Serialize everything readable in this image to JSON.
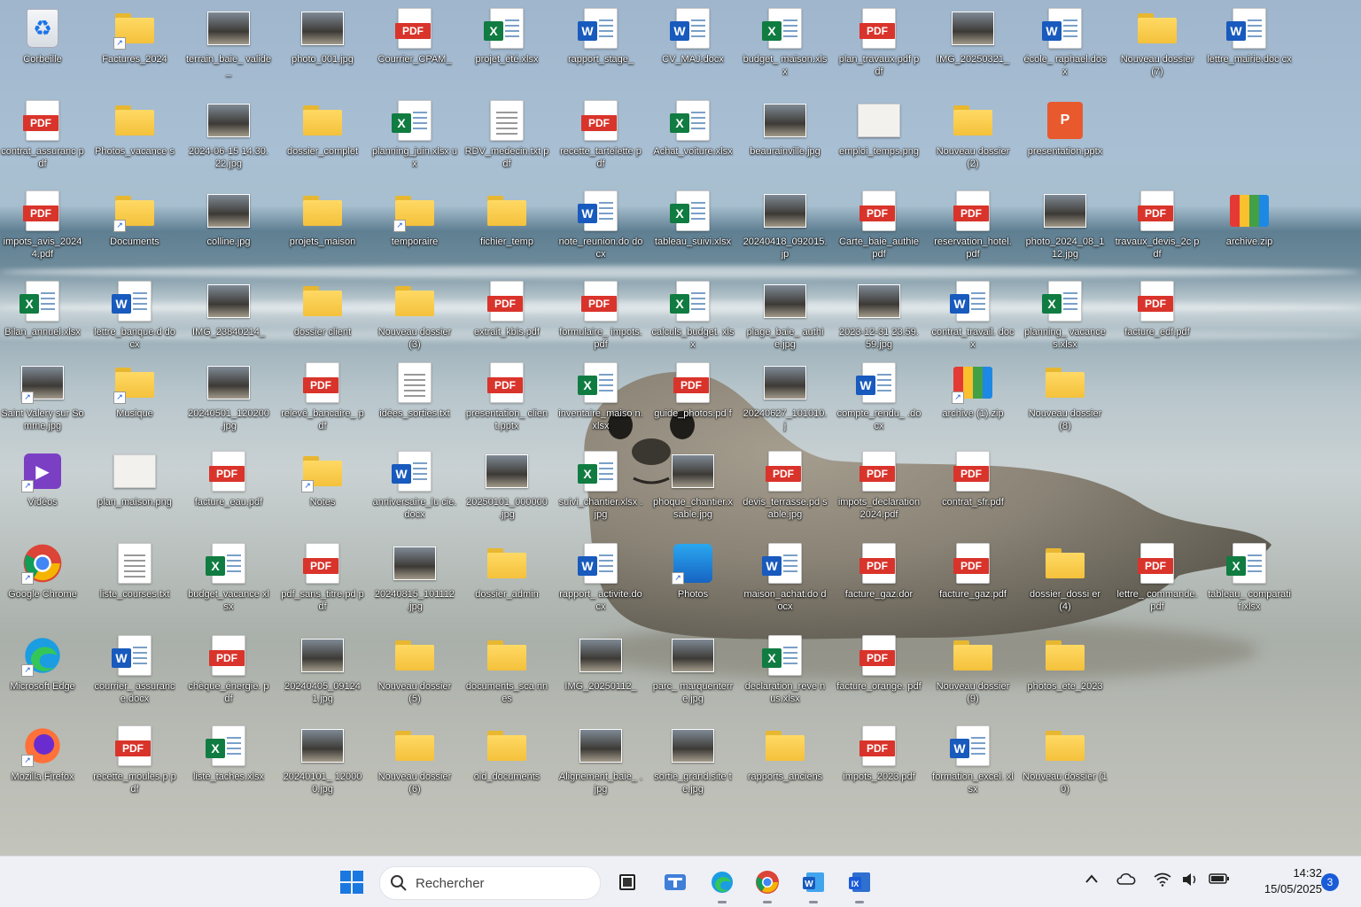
{
  "desktop": {
    "icons": [
      {
        "label": "Corbeille",
        "type": "recycle"
      },
      {
        "label": "Factures_2024",
        "type": "folder",
        "shortcut": true
      },
      {
        "label": "terrain_baie_ valide_",
        "type": "photo"
      },
      {
        "label": "photo_001.jpg",
        "type": "photo"
      },
      {
        "label": "Courrier_CPAM_",
        "type": "pdf"
      },
      {
        "label": "projet_été.xlsx",
        "type": "excel"
      },
      {
        "label": "rapport_stage_",
        "type": "word"
      },
      {
        "label": "CV_MAJ.docx",
        "type": "word"
      },
      {
        "label": "budget_ maison.xlsx",
        "type": "excel"
      },
      {
        "label": "plan_travaux.pdf pdf",
        "type": "pdf"
      },
      {
        "label": "IMG_20250321_",
        "type": "photo"
      },
      {
        "label": "école_ raphael.docx",
        "type": "word"
      },
      {
        "label": "Nouveau dossier (7)",
        "type": "folder"
      },
      {
        "label": "lettre_mairie.doc cx",
        "type": "word"
      },
      {
        "label": "contrat_assuranc pdf",
        "type": "pdf"
      },
      {
        "label": "Photos_vacance s",
        "type": "folder"
      },
      {
        "label": "2024-06-15 14.30.22.jpg",
        "type": "photo"
      },
      {
        "label": "dossier_complet",
        "type": "folder"
      },
      {
        "label": "planning_juin.xlsx ux",
        "type": "excel"
      },
      {
        "label": "RDV_medecin.txt pdf",
        "type": "txt"
      },
      {
        "label": "recette_tartelette pdf",
        "type": "pdf"
      },
      {
        "label": "Achat_voiture.xlsx",
        "type": "excel"
      },
      {
        "label": "beaurainville.jpg",
        "type": "photo"
      },
      {
        "label": "emploi_temps.png",
        "type": "png"
      },
      {
        "label": "Nouveau dossier (2)",
        "type": "folder"
      },
      {
        "label": "presentation.pptx",
        "type": "pptx"
      },
      {
        "label": "impots_avis_2024 4.pdf",
        "type": "pdf"
      },
      {
        "label": "Documents",
        "type": "folder",
        "shortcut": true
      },
      {
        "label": "colline.jpg",
        "type": "photo"
      },
      {
        "label": "projets_maison",
        "type": "folder"
      },
      {
        "label": "temporaire",
        "type": "folder",
        "shortcut": true
      },
      {
        "label": "fichier_temp",
        "type": "folder"
      },
      {
        "label": "note_reunion.do docx",
        "type": "word"
      },
      {
        "label": "tableau_suivi.xlsx",
        "type": "excel"
      },
      {
        "label": "20240418_092015.jp",
        "type": "photo"
      },
      {
        "label": "Carte_baie_authie pdf",
        "type": "pdf"
      },
      {
        "label": "reservation_hotel. pdf",
        "type": "pdf"
      },
      {
        "label": "photo_2024_08_1 12.jpg",
        "type": "photo"
      },
      {
        "label": "travaux_devis_2c pdf",
        "type": "pdf"
      },
      {
        "label": "archive.zip",
        "type": "zip"
      },
      {
        "label": "Bilan_annuel.xlsx",
        "type": "excel"
      },
      {
        "label": "lettre_banque.d docx",
        "type": "word"
      },
      {
        "label": "IMG_23840214_",
        "type": "photo"
      },
      {
        "label": "dossier client",
        "type": "folder"
      },
      {
        "label": "Nouveau dossier (3)",
        "type": "folder"
      },
      {
        "label": "extrait_kbis.pdf",
        "type": "pdf"
      },
      {
        "label": "formulaire_ impots.pdf",
        "type": "pdf"
      },
      {
        "label": "calculs_budget. xlsx",
        "type": "excel"
      },
      {
        "label": "plage_baie_ authie.jpg",
        "type": "photo"
      },
      {
        "label": "2023-12-31 23.59.59.jpg",
        "type": "photo"
      },
      {
        "label": "contrat_travail. docx",
        "type": "word"
      },
      {
        "label": "planning_ vacances.xlsx",
        "type": "excel"
      },
      {
        "label": "facture_edf.pdf",
        "type": "pdf"
      },
      {
        "label": "Saint Valery sur Somme.jpg",
        "type": "photo",
        "shortcut": true
      },
      {
        "label": "Musique",
        "type": "folder",
        "shortcut": true
      },
      {
        "label": "20240501_120200 .jpg",
        "type": "photo"
      },
      {
        "label": "relevé_bancaire_ pdf",
        "type": "pdf"
      },
      {
        "label": "idées_sorties.txt",
        "type": "txt"
      },
      {
        "label": "presentation_ client.pptx",
        "type": "pdf"
      },
      {
        "label": "inventaire_maiso n.xlsx",
        "type": "excel"
      },
      {
        "label": "guide_photos.pd f",
        "type": "pdf"
      },
      {
        "label": "20240627_101010.j",
        "type": "photo"
      },
      {
        "label": "compte_rendu_ .docx",
        "type": "word"
      },
      {
        "label": "archive (1).zip",
        "type": "zip",
        "shortcut": true
      },
      {
        "label": "Nouveau dossier (8)",
        "type": "folder"
      },
      {
        "label": "Vidéos",
        "type": "video",
        "shortcut": true
      },
      {
        "label": "plan_maison.png",
        "type": "png"
      },
      {
        "label": "facture_eau.pdf",
        "type": "pdf"
      },
      {
        "label": "Notes",
        "type": "folder",
        "shortcut": true
      },
      {
        "label": "anniversaire_lu cie.docx",
        "type": "word"
      },
      {
        "label": "20250101_000000 .jpg",
        "type": "photo"
      },
      {
        "label": "suivi_chantier.xlsx .jpg",
        "type": "excel"
      },
      {
        "label": "phoque_chantier.x sable.jpg",
        "type": "photo"
      },
      {
        "label": "devis_terrasse.pd sable.jpg",
        "type": "pdf"
      },
      {
        "label": "impots_declaration 2024.pdf",
        "type": "pdf"
      },
      {
        "label": "contrat_sfr.pdf",
        "type": "pdf"
      },
      {
        "label": "Google Chrome",
        "type": "chrome",
        "shortcut": true
      },
      {
        "label": "liste_courses.txt",
        "type": "txt"
      },
      {
        "label": "budget_vacance xlsx",
        "type": "excel"
      },
      {
        "label": "pdf_sans_titre.pd pdf",
        "type": "pdf"
      },
      {
        "label": "20240815_101112 .jpg",
        "type": "photo"
      },
      {
        "label": "dossier_admin",
        "type": "folder"
      },
      {
        "label": "rapport_ activite.docx",
        "type": "word"
      },
      {
        "label": "Photos",
        "type": "photosapp",
        "shortcut": true
      },
      {
        "label": "maison_achat.do docx",
        "type": "word"
      },
      {
        "label": "facture_gaz.dor",
        "type": "pdf"
      },
      {
        "label": "facture_gaz.pdf",
        "type": "pdf"
      },
      {
        "label": "dossier_dossi er (4)",
        "type": "folder"
      },
      {
        "label": "lettre_ commande.pdf",
        "type": "pdf"
      },
      {
        "label": "tableau_ comparatif.xlsx",
        "type": "excel"
      },
      {
        "label": "Microsoft Edge",
        "type": "edge",
        "shortcut": true
      },
      {
        "label": "courrier_ assurance.docx",
        "type": "word"
      },
      {
        "label": "chèque_énergie. pdf",
        "type": "pdf"
      },
      {
        "label": "20240405_09124 1.jpg",
        "type": "photo"
      },
      {
        "label": "Nouveau dossier (5)",
        "type": "folder"
      },
      {
        "label": "documents_sca nnes",
        "type": "folder"
      },
      {
        "label": "IMG_20250112_",
        "type": "photo"
      },
      {
        "label": "parc_ marquenterre.jpg",
        "type": "photo"
      },
      {
        "label": "declaration_reve nus.xlsx",
        "type": "excel"
      },
      {
        "label": "facture_orange. pdf",
        "type": "pdf"
      },
      {
        "label": "Nouveau dossier (9)",
        "type": "folder"
      },
      {
        "label": "photos_ete_2023",
        "type": "folder"
      },
      {
        "label": "Mozilla Firefox",
        "type": "firefox",
        "shortcut": true
      },
      {
        "label": "recette_moules.p pdf",
        "type": "pdf"
      },
      {
        "label": "liste_taches.xlsx",
        "type": "excel"
      },
      {
        "label": "20240101_ 120000.jpg",
        "type": "photo"
      },
      {
        "label": "Nouveau dossier (6)",
        "type": "folder"
      },
      {
        "label": "old_documents",
        "type": "folder"
      },
      {
        "label": "Alignement_baie_ .jpg",
        "type": "photo"
      },
      {
        "label": "sortie_grand.site te.jpg",
        "type": "photo"
      },
      {
        "label": "rapports_anciens",
        "type": "folder"
      },
      {
        "label": "impots_2023.pdf",
        "type": "pdf"
      },
      {
        "label": "formation_excel. xlsx",
        "type": "word"
      },
      {
        "label": "Nouveau dossier (10)",
        "type": "folder"
      }
    ]
  },
  "taskbar": {
    "search_placeholder": "Rechercher",
    "apps": [
      "start-icon",
      "task-view-icon",
      "teams-icon",
      "edge-icon",
      "chrome-icon",
      "word-icon",
      "excel-icon"
    ],
    "clock_time": "14:32",
    "clock_date": "15/05/2025",
    "notification_count": "3"
  },
  "colors": {
    "word": "#185abd",
    "excel": "#107c41",
    "pdf": "#d9342b",
    "folder": "#f4c13b",
    "accent": "#1a5bd8",
    "taskbar": "#eef0f5"
  }
}
